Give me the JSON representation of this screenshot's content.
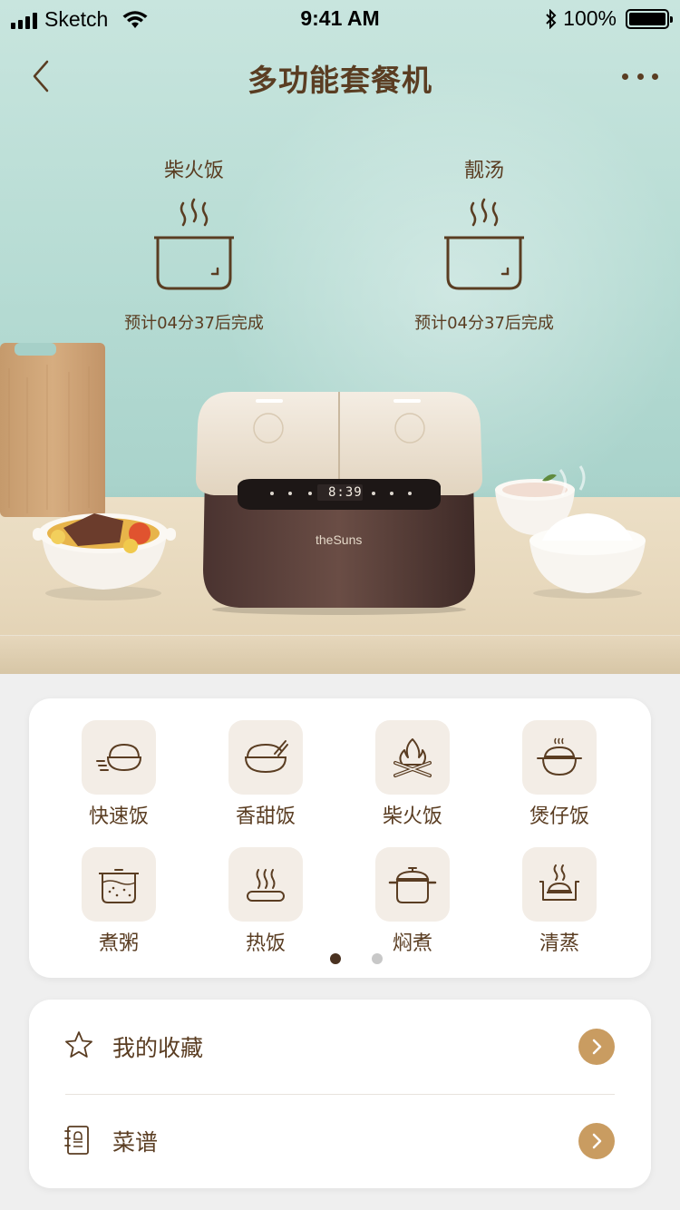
{
  "status_bar": {
    "carrier": "Sketch",
    "time": "9:41 AM",
    "battery": "100%",
    "battery_level": 1.0
  },
  "nav": {
    "title": "多功能套餐机"
  },
  "cooking": [
    {
      "name": "柴火饭",
      "eta": "预计04分37后完成"
    },
    {
      "name": "靓汤",
      "eta": "预计04分37后完成"
    }
  ],
  "appliance": {
    "brand": "theSuns",
    "display_time": "8:39"
  },
  "functions": [
    {
      "label": "快速饭",
      "icon": "fast-rice-icon"
    },
    {
      "label": "香甜饭",
      "icon": "sweet-rice-icon"
    },
    {
      "label": "柴火饭",
      "icon": "firewood-icon"
    },
    {
      "label": "煲仔饭",
      "icon": "claypot-icon"
    },
    {
      "label": "煮粥",
      "icon": "porridge-icon"
    },
    {
      "label": "热饭",
      "icon": "reheat-icon"
    },
    {
      "label": "焖煮",
      "icon": "stew-pot-icon"
    },
    {
      "label": "清蒸",
      "icon": "steam-icon"
    }
  ],
  "pagination": {
    "current": 1,
    "total": 2,
    "active_color": "#4a3220",
    "inactive_color": "#c8c8c8"
  },
  "menu": [
    {
      "label": "我的收藏",
      "icon": "star-icon"
    },
    {
      "label": "菜谱",
      "icon": "recipe-book-icon"
    }
  ],
  "colors": {
    "accent": "#c99c61",
    "text": "#5a3d22",
    "tile_bg": "#f3ede6"
  }
}
